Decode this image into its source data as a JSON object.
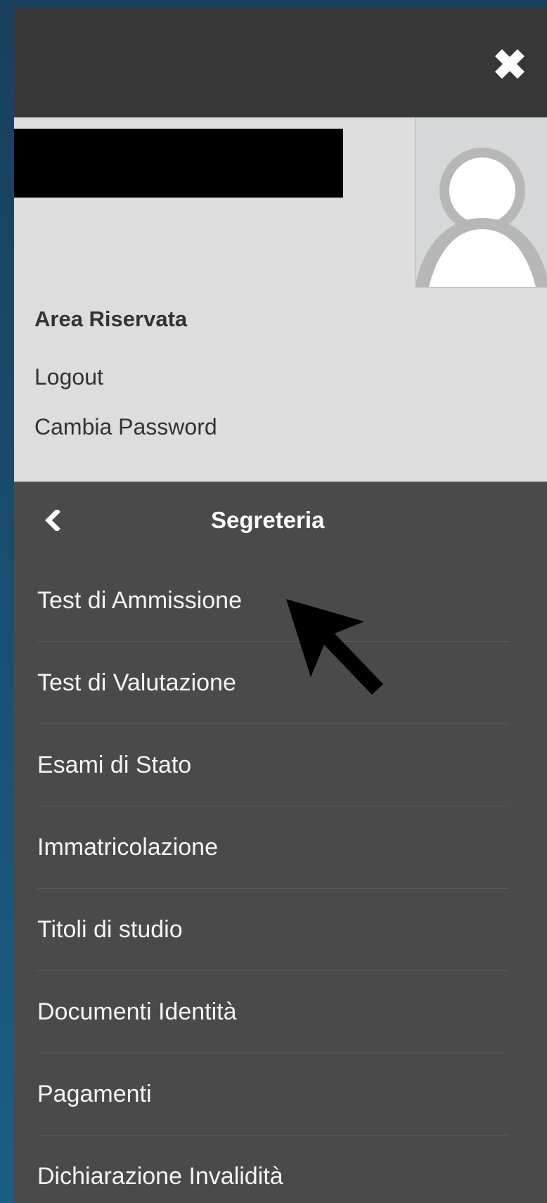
{
  "header": {
    "close_icon": "close-icon"
  },
  "user_area": {
    "redacted_name": "",
    "avatar_icon": "user-avatar-icon",
    "area_title": "Area Riservata",
    "logout_label": "Logout",
    "change_password_label": "Cambia Password"
  },
  "section": {
    "back_icon": "chevron-left-icon",
    "title": "Segreteria"
  },
  "menu": {
    "items": [
      {
        "label": "Test di Ammissione"
      },
      {
        "label": "Test di Valutazione"
      },
      {
        "label": "Esami di Stato"
      },
      {
        "label": "Immatricolazione"
      },
      {
        "label": "Titoli di studio"
      },
      {
        "label": "Documenti Identità"
      },
      {
        "label": "Pagamenti"
      },
      {
        "label": "Dichiarazione Invalidità"
      }
    ]
  },
  "colors": {
    "page_background": "#1b5e85",
    "top_bar": "#373737",
    "user_area_bg": "#dddddd",
    "menu_bg": "#4a4a4a",
    "menu_text": "#f4f4f4",
    "user_text": "#333333",
    "divider": "#595959"
  }
}
